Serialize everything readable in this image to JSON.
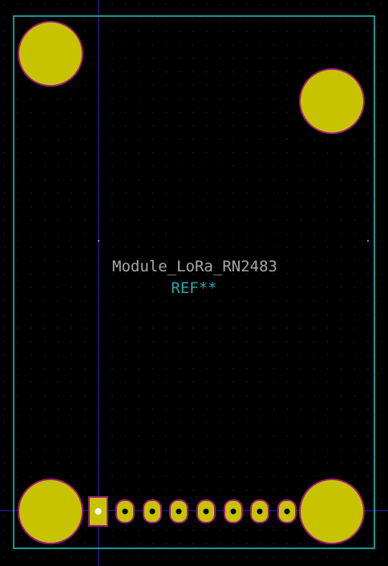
{
  "footprint": {
    "value_text": "Module_LoRa_RN2483",
    "reference_text": "REF**"
  },
  "colors": {
    "background": "#000000",
    "grid_dot": "#3a3a3a",
    "courtyard": "#26c6c6",
    "axis_line": "#2a2ad0",
    "pad_fill": "#c8c300",
    "pad_outline": "#a01a7a",
    "value_text": "#a8a8a8",
    "reference_text": "#2aa8a8",
    "drill": "#ffffff"
  },
  "pads": {
    "mounting_hole_count": 4,
    "signal_pad_count": 8,
    "pin1_shape": "rect",
    "other_pins_shape": "oval"
  }
}
